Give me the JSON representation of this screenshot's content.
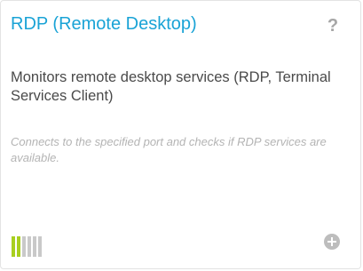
{
  "card": {
    "title": "RDP (Remote Desktop)",
    "help_icon": "question-mark-icon",
    "help_glyph": "?",
    "description": "Monitors remote desktop services (RDP, Terminal Services Client)",
    "note": "Connects to the specified port and checks if RDP services are available.",
    "level": {
      "filled": 2,
      "total": 6,
      "accent_color": "#a8cf1f"
    },
    "add_icon": "plus-circle-icon"
  },
  "colors": {
    "title": "#1aa3d6",
    "description": "#4a4a4a",
    "note": "#b4b4b4",
    "icon": "#bdbdbd"
  }
}
